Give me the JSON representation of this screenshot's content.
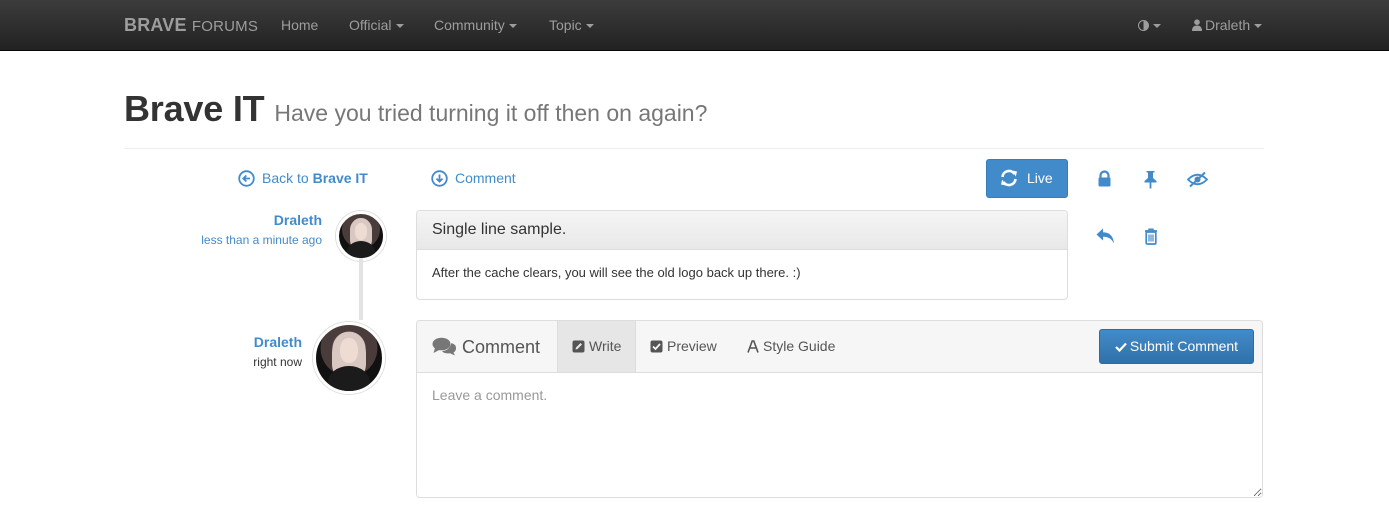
{
  "navbar": {
    "brand_bold": "BRAVE",
    "brand_thin": "FORUMS",
    "items": [
      {
        "label": "Home"
      },
      {
        "label": "Official"
      },
      {
        "label": "Community"
      },
      {
        "label": "Topic"
      }
    ],
    "user": "Draleth"
  },
  "page": {
    "title": "Brave IT",
    "subtitle": "Have you tried turning it off then on again?"
  },
  "actions": {
    "back_prefix": "Back to",
    "back_target": "Brave IT",
    "comment_link": "Comment",
    "live_label": "Live"
  },
  "posts": [
    {
      "author": "Draleth",
      "time": "less than a minute ago",
      "title": "Single line sample.",
      "body": "After the cache clears, you will see the old logo back up there. :)"
    }
  ],
  "composer": {
    "author": "Draleth",
    "time": "right now",
    "header": "Comment",
    "tabs": [
      {
        "label": "Write",
        "icon": "pencil-square-icon",
        "active": true
      },
      {
        "label": "Preview",
        "icon": "check-square-icon",
        "active": false
      },
      {
        "label": "Style Guide",
        "icon": "font-icon",
        "active": false
      }
    ],
    "submit_label": "Submit Comment",
    "placeholder": "Leave a comment."
  },
  "colors": {
    "accent": "#428bca",
    "navbar": "#222222"
  }
}
